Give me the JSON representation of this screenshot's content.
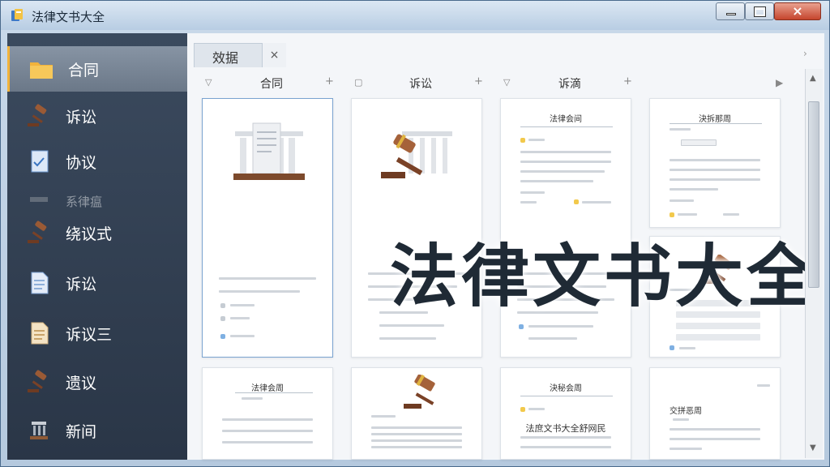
{
  "window": {
    "title": "法律文书大全",
    "close_glyph": "×"
  },
  "sidebar": {
    "items": [
      {
        "label": "合同",
        "icon": "folder-icon"
      },
      {
        "label": "诉讼",
        "icon": "gavel-icon"
      },
      {
        "label": "协议",
        "icon": "document-icon"
      },
      {
        "label": "系律瘟",
        "icon": "gavel-icon"
      },
      {
        "label": "绕议式",
        "icon": "gavel-icon"
      },
      {
        "label": "诉讼",
        "icon": "document-icon"
      },
      {
        "label": "诉议三",
        "icon": "document-icon"
      },
      {
        "label": "遗议",
        "icon": "gavel-icon"
      },
      {
        "label": "新间",
        "icon": "court-icon"
      }
    ]
  },
  "tabs": [
    {
      "label": "效据",
      "close": "×"
    }
  ],
  "columns": [
    "合同",
    "诉讼",
    "诉滴"
  ],
  "cards": {
    "c3_title": "法律会间",
    "c4_title": "決拆那周",
    "c7_title": "法律会周",
    "c9_title": "決秘会周",
    "c9_text": "法庶文书大全舒网民",
    "c10_title": "交拼恶周"
  },
  "overlay": {
    "text": "法律文书大全"
  },
  "colors": {
    "sidebar_bg": "#33404f",
    "accent": "#f2b33b",
    "gavel": "#8a4b2a"
  }
}
